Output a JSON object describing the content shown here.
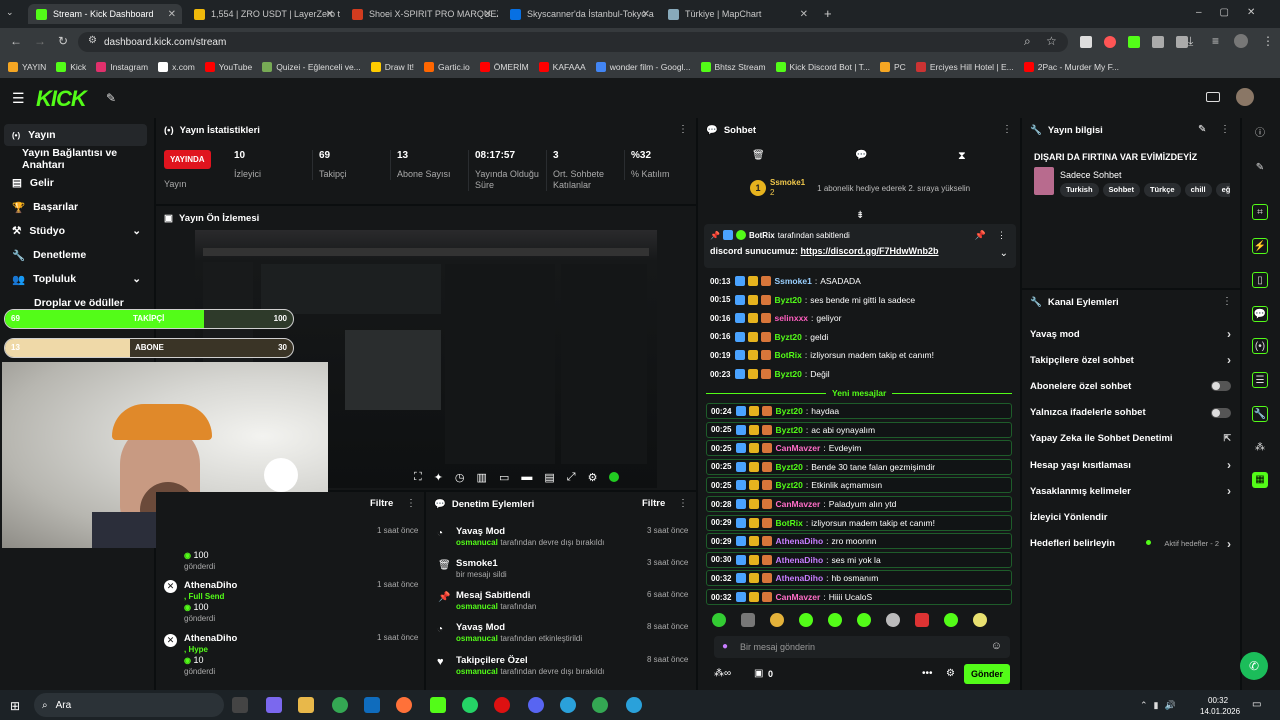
{
  "browser": {
    "tabs": [
      {
        "label": "Stream - Kick Dashboard",
        "color": "#53fc18"
      },
      {
        "label": "1,554 | ZRO USDT | LayerZero t",
        "color": "#f0b90b"
      },
      {
        "label": "Shoei X-SPIRIT PRO MARQUEZ",
        "color": "#d13c1f"
      },
      {
        "label": "Skyscanner'da İstanbul-Tokyo a",
        "color": "#0770e3"
      },
      {
        "label": "Türkiye | MapChart",
        "color": "#8ab"
      }
    ],
    "url": "dashboard.kick.com/stream",
    "bookmarks": [
      {
        "label": "YAYIN",
        "color": "#f5a623"
      },
      {
        "label": "Kick",
        "color": "#53fc18"
      },
      {
        "label": "Instagram",
        "color": "#e1306c"
      },
      {
        "label": "x.com",
        "color": "#fff"
      },
      {
        "label": "YouTube",
        "color": "#f00"
      },
      {
        "label": "Quizei - Eğlenceli ve...",
        "color": "#7a5"
      },
      {
        "label": "Draw It!",
        "color": "#fc0"
      },
      {
        "label": "Gartic.io",
        "color": "#f60"
      },
      {
        "label": "ÖMERİM",
        "color": "#f00"
      },
      {
        "label": "KAFAAA",
        "color": "#f00"
      },
      {
        "label": "wonder film - Googl...",
        "color": "#4285f4"
      },
      {
        "label": "Bhtsz Stream",
        "color": "#53fc18"
      },
      {
        "label": "Kick Discord Bot | T...",
        "color": "#53fc18"
      },
      {
        "label": "PC",
        "color": "#f5a623"
      },
      {
        "label": "Erciyes Hill Hotel | E...",
        "color": "#c33"
      },
      {
        "label": "2Pac - Murder My F...",
        "color": "#f00"
      }
    ]
  },
  "sidebar": {
    "items": [
      "Yayın",
      "Yayın Bağlantısı ve Anahtarı",
      "Gelir",
      "Başarılar",
      "Stüdyo",
      "Denetleme",
      "Topluluk",
      "Droplar ve ödüller"
    ]
  },
  "overlay": {
    "follow_count": "69",
    "follow_label": "TAKİPÇİ",
    "follow_goal": "100",
    "follow_fraction": 0.69,
    "sub_count": "13",
    "sub_label": "ABONE",
    "sub_goal": "30",
    "sub_fraction": 0.433
  },
  "stats": {
    "title": "Yayın İstatistikleri",
    "live": "YAYINDA",
    "live_label": "Yayın",
    "cols": [
      {
        "value": "10",
        "label": "İzleyici"
      },
      {
        "value": "69",
        "label": "Takipçi"
      },
      {
        "value": "13",
        "label": "Abone Sayısı"
      },
      {
        "value": "08:17:57",
        "label": "Yayında Olduğu Süre"
      },
      {
        "value": "3",
        "label": "Ort. Sohbete Katılanlar"
      },
      {
        "value": "%32",
        "label": "% Katılım"
      }
    ]
  },
  "preview": {
    "title": "Yayın Ön İzlemesi"
  },
  "recent": {
    "filter": "Filtre",
    "items": [
      {
        "time": "1 saat önce",
        "amount": "100",
        "sent": "gönderdi"
      },
      {
        "user": "AthenaDiho",
        "type": ", Full Send",
        "amount": "100",
        "sent": "gönderdi",
        "time": "1 saat önce"
      },
      {
        "user": "AthenaDiho",
        "type": ", Hype",
        "amount": "10",
        "sent": "gönderdi",
        "time": "1 saat önce"
      }
    ]
  },
  "modlog": {
    "title": "Denetim Eylemleri",
    "filter": "Filtre",
    "items": [
      {
        "title": "Yavaş Mod",
        "user": "osmanucal",
        "desc": "tarafından devre dışı bırakıldı",
        "time": "3 saat önce"
      },
      {
        "title": "Ssmoke1",
        "user": "",
        "desc": "bir mesajı sildi",
        "time": "3 saat önce"
      },
      {
        "title": "Mesaj Sabitlendi",
        "user": "osmanucal",
        "desc": "tarafından",
        "time": "6 saat önce"
      },
      {
        "title": "Yavaş Mod",
        "user": "osmanucal",
        "desc": "tarafından etkinleştirildi",
        "time": "8 saat önce"
      },
      {
        "title": "Takipçilere Özel",
        "user": "osmanucal",
        "desc": "tarafından devre dışı bırakıldı",
        "time": "8 saat önce"
      }
    ]
  },
  "chat": {
    "title": "Sohbet",
    "gift_user": "Ssmoke1",
    "gift_count": "2",
    "gift_text": "1 abonelik hediye ederek 2. sıraya yükselin",
    "pinned_by": "BotRix",
    "pinned_label": "tarafından sabitlendi",
    "pinned_prefix": "discord sunucumuz:",
    "pinned_link": "https://discord.gg/F7HdwWnb2b",
    "new_label": "Yeni mesajlar",
    "messages": [
      {
        "t": "00:13",
        "u": "Ssmoke1",
        "c": "#9ad0ff",
        "m": "ASADADA"
      },
      {
        "t": "00:15",
        "u": "Byzt20",
        "c": "#53fc18",
        "m": "ses bende mi gitti la sadece"
      },
      {
        "t": "00:16",
        "u": "selinxxx",
        "c": "#ff5ebf",
        "m": "geliyor"
      },
      {
        "t": "00:16",
        "u": "Byzt20",
        "c": "#53fc18",
        "m": "geldi"
      },
      {
        "t": "00:19",
        "u": "BotRix",
        "c": "#53fc18",
        "m": "izliyorsun madem takip et canım!"
      },
      {
        "t": "00:23",
        "u": "Byzt20",
        "c": "#53fc18",
        "m": "Değil"
      }
    ],
    "new_messages": [
      {
        "t": "00:24",
        "u": "Byzt20",
        "c": "#53fc18",
        "m": "haydaa"
      },
      {
        "t": "00:25",
        "u": "Byzt20",
        "c": "#53fc18",
        "m": "ac abi oynayalım"
      },
      {
        "t": "00:25",
        "u": "CanMavzer",
        "c": "#ff6ec7",
        "m": "Evdeyim"
      },
      {
        "t": "00:25",
        "u": "Byzt20",
        "c": "#53fc18",
        "m": "Bende 30 tane falan gezmişimdir"
      },
      {
        "t": "00:25",
        "u": "Byzt20",
        "c": "#53fc18",
        "m": "Etkinlik açmamısın"
      },
      {
        "t": "00:28",
        "u": "CanMavzer",
        "c": "#ff6ec7",
        "m": "Paladyum alın ytd"
      },
      {
        "t": "00:29",
        "u": "BotRix",
        "c": "#53fc18",
        "m": "izliyorsun madem takip et canım!"
      },
      {
        "t": "00:29",
        "u": "AthenaDiho",
        "c": "#c77dff",
        "m": "zro moonnn"
      },
      {
        "t": "00:30",
        "u": "AthenaDiho",
        "c": "#c77dff",
        "m": "ses mi yok la"
      },
      {
        "t": "00:32",
        "u": "AthenaDiho",
        "c": "#c77dff",
        "m": "hb osmanım"
      },
      {
        "t": "00:32",
        "u": "CanMavzer",
        "c": "#ff6ec7",
        "m": "Hiiii UcaloS"
      }
    ],
    "placeholder": "Bir mesaj gönderin",
    "points": "0",
    "send": "Gönder"
  },
  "info": {
    "title": "Yayın bilgisi",
    "stream_title": "DIŞARI DA FIRTINA VAR EVİMİZDEYİZ",
    "category": "Sadece Sohbet",
    "tags": [
      "Turkish",
      "Sohbet",
      "Türkçe",
      "chill",
      "eğlen"
    ]
  },
  "actions": {
    "title": "Kanal Eylemleri",
    "items": [
      {
        "label": "Yavaş mod",
        "ctrl": "chev"
      },
      {
        "label": "Takipçilere özel sohbet",
        "ctrl": "chev"
      },
      {
        "label": "Abonelere özel sohbet",
        "ctrl": "toggle"
      },
      {
        "label": "Yalnızca ifadelerle sohbet",
        "ctrl": "toggle"
      },
      {
        "label": "Yapay Zeka ile Sohbet Denetimi",
        "ctrl": "ext"
      },
      {
        "label": "Hesap yaşı kısıtlaması",
        "ctrl": "chev"
      },
      {
        "label": "Yasaklanmış kelimeler",
        "ctrl": "chev"
      },
      {
        "label": "İzleyici Yönlendir",
        "ctrl": "none"
      },
      {
        "label": "Hedefleri belirleyin",
        "ctrl": "chev"
      }
    ],
    "goals_active": "Aktif hedefler - 2"
  },
  "taskbar": {
    "search": "Ara",
    "time": "00:32",
    "date": "14.01.2026"
  }
}
